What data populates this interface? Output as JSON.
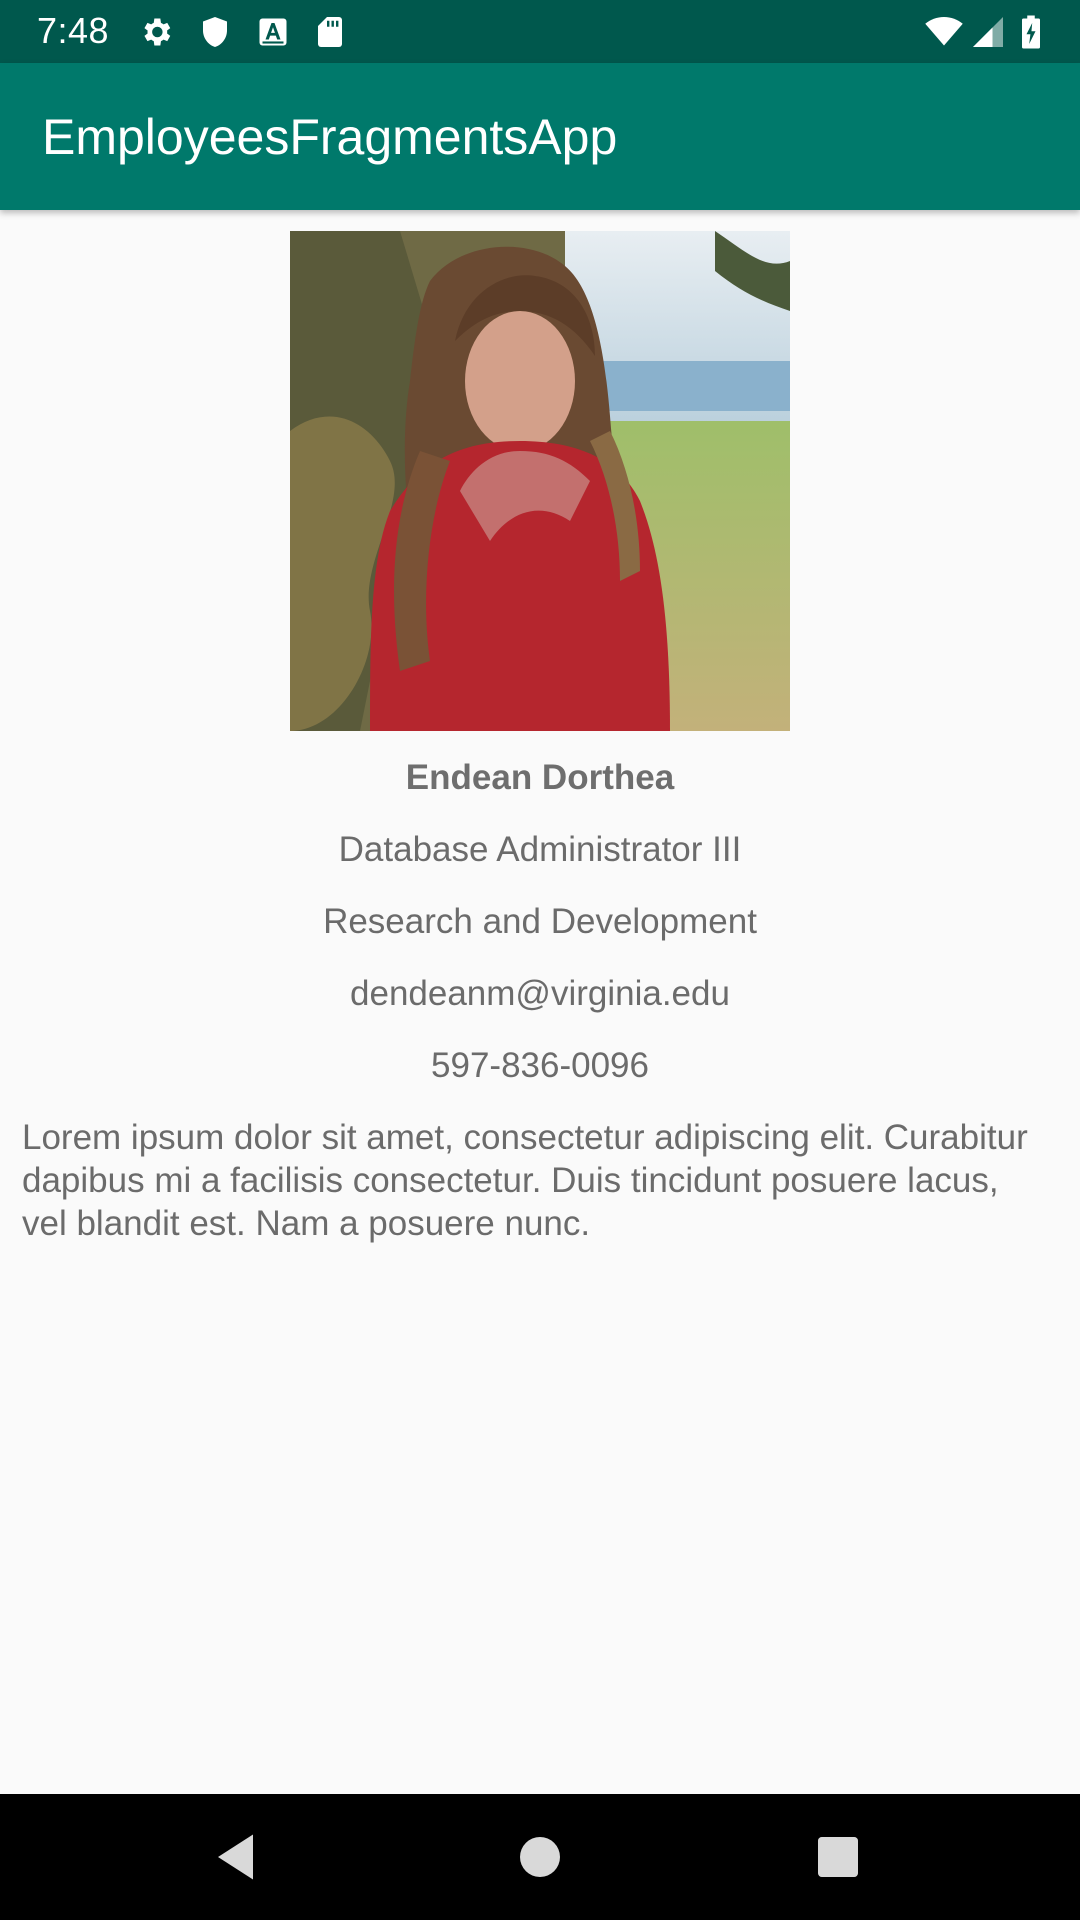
{
  "status_bar": {
    "time": "7:48",
    "left_icons": [
      "gear-icon",
      "shield-icon",
      "font-download-icon",
      "sd-card-icon"
    ],
    "right_icons": [
      "wifi-icon",
      "cell-signal-icon",
      "battery-charging-icon"
    ],
    "background": "#00584d"
  },
  "app_bar": {
    "title": "EmployeesFragmentsApp",
    "background": "#00796b"
  },
  "employee": {
    "photo_icon": "employee-photo",
    "name": "Endean Dorthea",
    "job_title": "Database Administrator III",
    "department": "Research and Development",
    "email": "dendeanm@virginia.edu",
    "phone": "597-836-0096",
    "description": "Lorem ipsum dolor sit amet, consectetur adipiscing elit. Curabitur dapibus mi a facilisis consectetur. Duis tincidunt posuere lacus, vel blandit est. Nam a posuere nunc."
  },
  "nav_bar": {
    "buttons": [
      "back-icon",
      "home-icon",
      "recents-icon"
    ],
    "background": "#000000"
  }
}
